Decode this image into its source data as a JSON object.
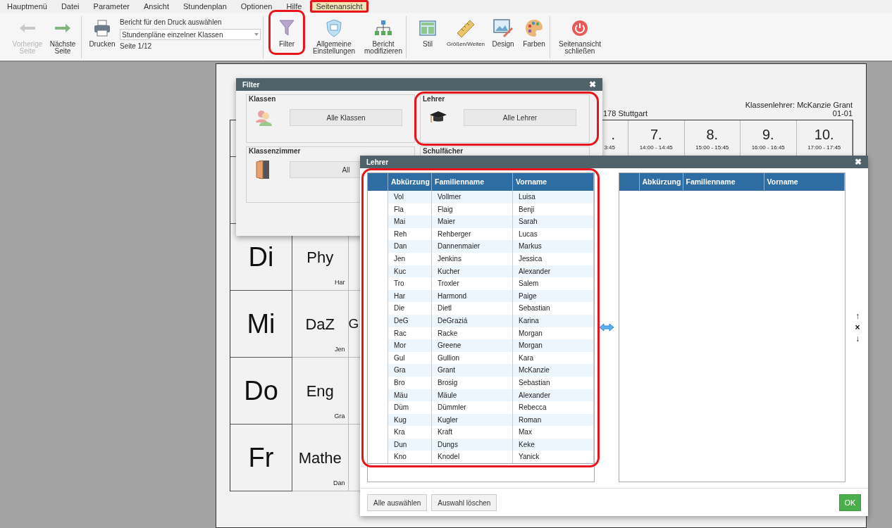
{
  "menu": [
    {
      "label": "Hauptmenü",
      "selected": false,
      "highlighted": false
    },
    {
      "label": "Datei",
      "selected": false,
      "highlighted": false
    },
    {
      "label": "Parameter",
      "selected": false,
      "highlighted": false
    },
    {
      "label": "Ansicht",
      "selected": false,
      "highlighted": false
    },
    {
      "label": "Stundenplan",
      "selected": false,
      "highlighted": false
    },
    {
      "label": "Optionen",
      "selected": false,
      "highlighted": false
    },
    {
      "label": "Hilfe",
      "selected": false,
      "highlighted": false
    },
    {
      "label": "Seitenansicht",
      "selected": true,
      "highlighted": true
    }
  ],
  "toolbar": [
    {
      "kind": "prev",
      "label": "Vorherige\nSeite",
      "disabled": true,
      "highlighted": false
    },
    {
      "kind": "next",
      "label": "Nächste\nSeite",
      "disabled": false,
      "highlighted": false
    },
    {
      "kind": "separator"
    },
    {
      "kind": "print",
      "label": "Drucken",
      "disabled": false,
      "highlighted": false
    },
    {
      "kind": "report_select",
      "label": "Bericht für den Druck auswählen",
      "value": "Stundenpläne einzelner Klassen",
      "page": "Seite 1/12"
    },
    {
      "kind": "separator"
    },
    {
      "kind": "filter",
      "label": "Filter",
      "disabled": false,
      "highlighted": true
    },
    {
      "kind": "settings",
      "label": "Allgemeine\nEinstellungen",
      "disabled": false,
      "highlighted": false
    },
    {
      "kind": "hierarchy",
      "label": "Bericht\nmodifizieren",
      "disabled": false,
      "highlighted": false
    },
    {
      "kind": "separator"
    },
    {
      "kind": "style",
      "label": "Stil",
      "disabled": false,
      "highlighted": false
    },
    {
      "kind": "ruler",
      "label": "Größen/Weiten",
      "disabled": false,
      "highlighted": false
    },
    {
      "kind": "design",
      "label": "Design",
      "disabled": false,
      "highlighted": false
    },
    {
      "kind": "palette",
      "label": "Farben",
      "disabled": false,
      "highlighted": false
    },
    {
      "kind": "separator"
    },
    {
      "kind": "power",
      "label": "Seitenansicht\nschließen",
      "disabled": false,
      "highlighted": false
    }
  ],
  "preview": {
    "address": "178 Stuttgart",
    "class_teacher": "Klassenlehrer: McKanzie Grant",
    "class_code": "01-01",
    "cut_period": {
      "number": ".",
      "time": "3:45"
    },
    "periods": [
      {
        "number": "7.",
        "time": "14:00 - 14:45"
      },
      {
        "number": "8.",
        "time": "15:00 - 15:45"
      },
      {
        "number": "9.",
        "time": "16:00 - 16:45"
      },
      {
        "number": "10.",
        "time": "17:00 - 17:45"
      }
    ],
    "rows": [
      {
        "day": "Di",
        "cells": [
          {
            "subject": "Phy",
            "teacher": "Har"
          }
        ]
      },
      {
        "day": "Mi",
        "cells": [
          {
            "subject": "DaZ",
            "teacher": "Jen"
          },
          {
            "subject": "G"
          }
        ]
      },
      {
        "day": "Do",
        "cells": [
          {
            "subject": "Eng",
            "teacher": "Gra"
          }
        ]
      },
      {
        "day": "Fr",
        "cells": [
          {
            "subject": "Mathe",
            "teacher": "Dan"
          }
        ]
      }
    ]
  },
  "filter_dialog": {
    "title": "Filter",
    "close": "✖",
    "groups": [
      {
        "title": "Klassen",
        "kind": "classes",
        "button": "Alle Klassen",
        "highlighted": false
      },
      {
        "title": "Lehrer",
        "kind": "teachers",
        "button": "Alle Lehrer",
        "highlighted": true
      },
      {
        "title": "Klassenzimmer",
        "kind": "rooms",
        "button": "All",
        "highlighted": false
      },
      {
        "title": "Schulfächer",
        "kind": "subjects",
        "highlighted": false
      }
    ]
  },
  "teacher_dialog": {
    "title": "Lehrer",
    "close": "✖",
    "columns": [
      "Abkürzung",
      "Familienname",
      "Vorname"
    ],
    "highlighted": true,
    "rows": [
      [
        "Vol",
        "Vollmer",
        "Luisa"
      ],
      [
        "Fla",
        "Flaig",
        "Benji"
      ],
      [
        "Mai",
        "Maier",
        "Sarah"
      ],
      [
        "Reh",
        "Rehberger",
        "Lucas"
      ],
      [
        "Dan",
        "Dannenmaier",
        "Markus"
      ],
      [
        "Jen",
        "Jenkins",
        "Jessica"
      ],
      [
        "Kuc",
        "Kucher",
        "Alexander"
      ],
      [
        "Tro",
        "Troxler",
        "Salem"
      ],
      [
        "Har",
        "Harmond",
        "Paige"
      ],
      [
        "Die",
        "Dietl",
        "Sebastian"
      ],
      [
        "DeG",
        "DeGraziá",
        "Karina"
      ],
      [
        "Rac",
        "Racke",
        "Morgan"
      ],
      [
        "Mor",
        "Greene",
        "Morgan"
      ],
      [
        "Gul",
        "Gullion",
        "Kara"
      ],
      [
        "Gra",
        "Grant",
        "McKanzie"
      ],
      [
        "Bro",
        "Brosig",
        "Sebastian"
      ],
      [
        "Mäu",
        "Mäule",
        "Alexander"
      ],
      [
        "Düm",
        "Dümmler",
        "Rebecca"
      ],
      [
        "Kug",
        "Kugler",
        "Roman"
      ],
      [
        "Kra",
        "Kraft",
        "Max"
      ],
      [
        "Dun",
        "Dungs",
        "Keke"
      ],
      [
        "Kno",
        "Knodel",
        "Yanick"
      ]
    ],
    "selected_columns": [
      "Abkürzung",
      "Familienname",
      "Vorname"
    ],
    "side_controls": [
      "↑",
      "×",
      "↓"
    ],
    "buttons": [
      "Alle auswählen",
      "Auswahl löschen"
    ],
    "ok": "OK"
  }
}
